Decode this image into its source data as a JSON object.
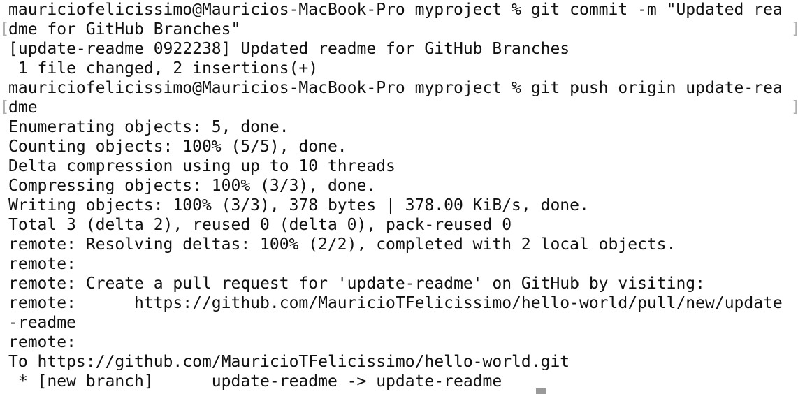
{
  "terminal": {
    "lines": [
      "mauriciofelicissimo@Mauricios-MacBook-Pro myproject % git commit -m \"Updated rea",
      "dme for GitHub Branches\"",
      "[update-readme 0922238] Updated readme for GitHub Branches",
      " 1 file changed, 2 insertions(+)",
      "mauriciofelicissimo@Mauricios-MacBook-Pro myproject % git push origin update-rea",
      "dme",
      "Enumerating objects: 5, done.",
      "Counting objects: 100% (5/5), done.",
      "Delta compression using up to 10 threads",
      "Compressing objects: 100% (3/3), done.",
      "Writing objects: 100% (3/3), 378 bytes | 378.00 KiB/s, done.",
      "Total 3 (delta 2), reused 0 (delta 0), pack-reused 0",
      "remote: Resolving deltas: 100% (2/2), completed with 2 local objects.",
      "remote:",
      "remote: Create a pull request for 'update-readme' on GitHub by visiting:",
      "remote:      https://github.com/MauricioTFelicissimo/hello-world/pull/new/update",
      "-readme",
      "remote:",
      "To https://github.com/MauricioTFelicissimo/hello-world.git",
      " * [new branch]      update-readme -> update-readme"
    ],
    "wrap_open_mark": "[",
    "wrap_close_mark": "]"
  }
}
